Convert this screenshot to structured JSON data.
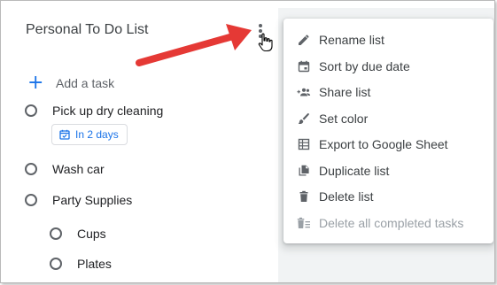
{
  "list": {
    "title": "Personal To Do List",
    "add_task_label": "Add a task",
    "tasks": [
      {
        "label": "Pick up dry cleaning",
        "due_chip": "In 2 days"
      },
      {
        "label": "Wash car"
      },
      {
        "label": "Party Supplies",
        "subtasks": [
          {
            "label": "Cups"
          },
          {
            "label": "Plates"
          }
        ]
      }
    ]
  },
  "menu": {
    "items": [
      {
        "label": "Rename list",
        "icon": "pencil-icon"
      },
      {
        "label": "Sort by due date",
        "icon": "calendar-icon"
      },
      {
        "label": "Share list",
        "icon": "share-people-icon"
      },
      {
        "label": "Set color",
        "icon": "brush-icon"
      },
      {
        "label": "Export to Google Sheet",
        "icon": "sheet-icon"
      },
      {
        "label": "Duplicate list",
        "icon": "copy-icon"
      },
      {
        "label": "Delete list",
        "icon": "trash-icon"
      },
      {
        "label": "Delete all completed tasks",
        "icon": "trash-lines-icon",
        "disabled": true
      }
    ]
  },
  "colors": {
    "accent": "#1a73e8",
    "annotation_arrow": "#e53935",
    "icon_gray": "#5f6368",
    "disabled_text": "#9aa0a6"
  }
}
